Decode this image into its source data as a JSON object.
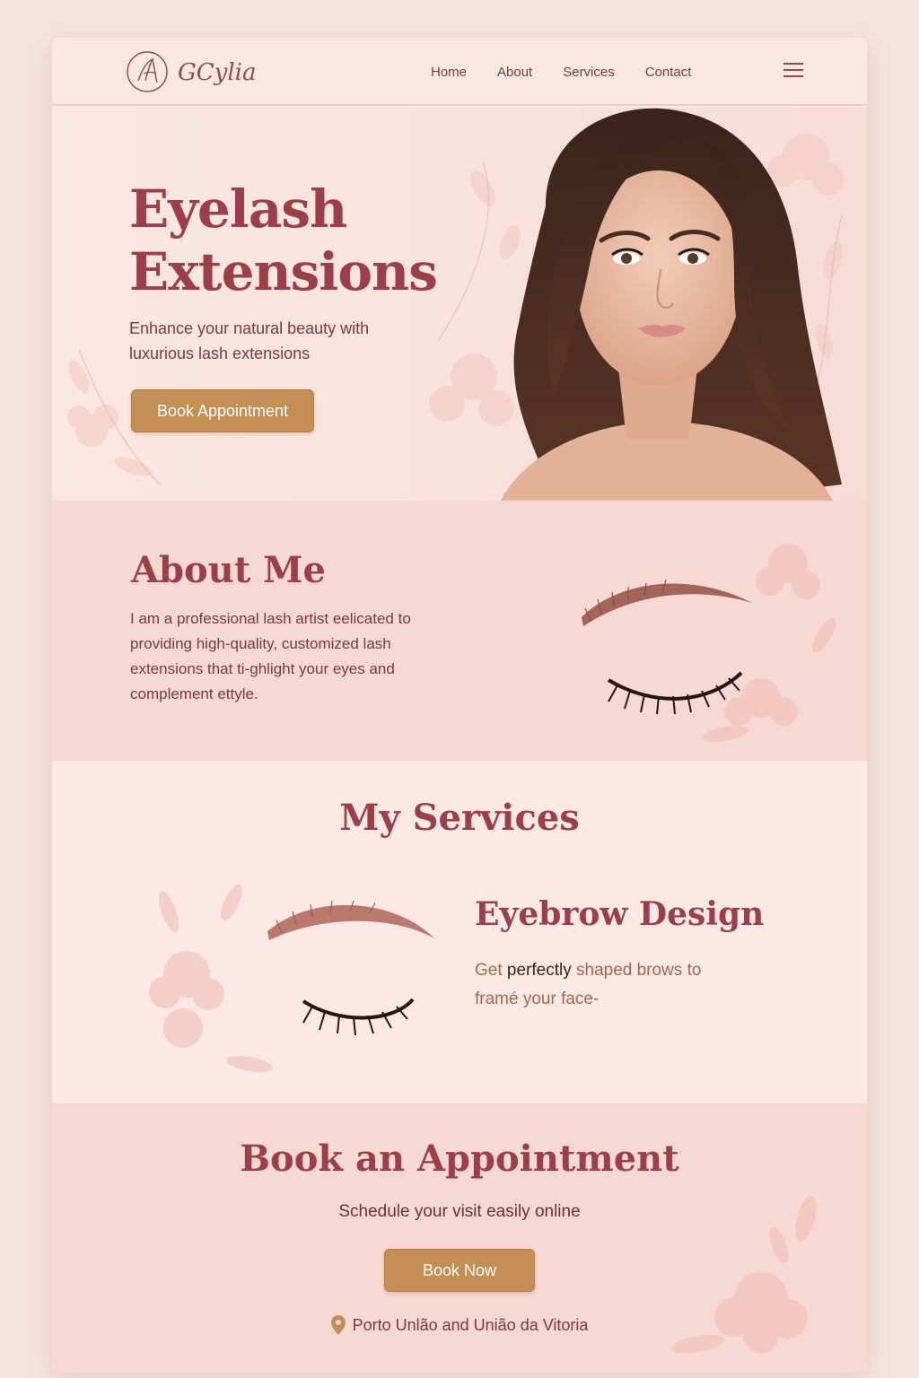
{
  "header": {
    "logo_text": "GCylia",
    "nav": [
      "Home",
      "About",
      "Services",
      "Contact"
    ]
  },
  "hero": {
    "title_line1": "Eyelash",
    "title_line2": "Extensions",
    "subtitle": "Enhance your natural beauty with luxurious lash extensions",
    "cta_label": "Book Appointment"
  },
  "about": {
    "title": "About Me",
    "text": "I am a professional lash artist eelicated to providing high-quality, customized lash extensions that ti-ghlight your eyes and complement ettyle."
  },
  "services": {
    "title": "My Services",
    "item_title": "Eyebrow Design",
    "item_desc_pre": "Get ",
    "item_desc_emph": "perfectly",
    "item_desc_post": " shaped brows to framé your face-"
  },
  "booking": {
    "title": "Book an Appointment",
    "subtitle": "Schedule your visit easily online",
    "cta_label": "Book Now",
    "location": "Porto Unlão and União da Vitoria"
  },
  "colors": {
    "accent": "#9b3f4b",
    "button": "#c48f55",
    "background": "#fbe9e4",
    "section_pink": "#f6d9d3"
  },
  "icons": [
    "logo-monogram-icon",
    "menu-icon",
    "location-pin-icon"
  ]
}
